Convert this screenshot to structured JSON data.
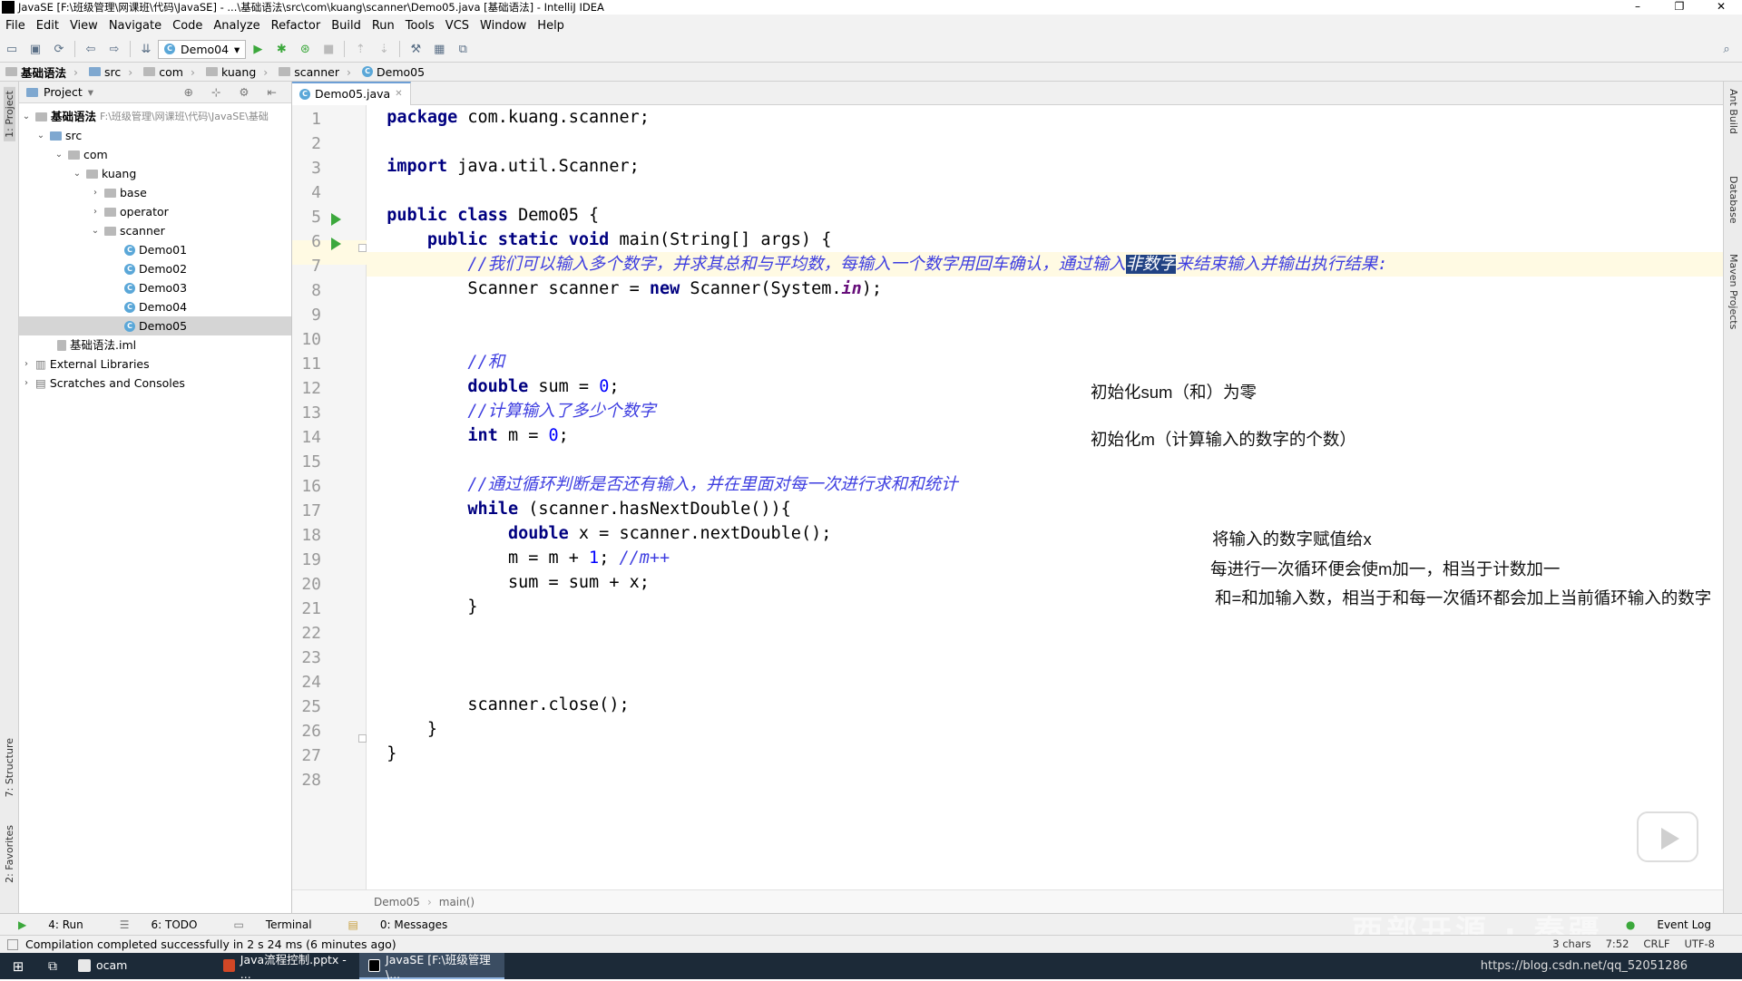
{
  "window": {
    "title": "JavaSE [F:\\班级管理\\网课班\\代码\\JavaSE] - ...\\基础语法\\src\\com\\kuang\\scanner\\Demo05.java [基础语法] - IntelliJ IDEA",
    "minimize": "–",
    "restore": "❐",
    "close": "✕"
  },
  "menu": [
    "File",
    "Edit",
    "View",
    "Navigate",
    "Code",
    "Analyze",
    "Refactor",
    "Build",
    "Run",
    "Tools",
    "VCS",
    "Window",
    "Help"
  ],
  "toolbar": {
    "run_config": "Demo04"
  },
  "breadcrumb": [
    "基础语法",
    "src",
    "com",
    "kuang",
    "scanner",
    "Demo05"
  ],
  "project_panel": {
    "title": "Project",
    "tree": [
      {
        "label": "基础语法",
        "hint": "F:\\班级管理\\网课班\\代码\\JavaSE\\基础"
      },
      {
        "label": "src"
      },
      {
        "label": "com"
      },
      {
        "label": "kuang"
      },
      {
        "label": "base"
      },
      {
        "label": "operator"
      },
      {
        "label": "scanner"
      },
      {
        "label": "Demo01"
      },
      {
        "label": "Demo02"
      },
      {
        "label": "Demo03"
      },
      {
        "label": "Demo04"
      },
      {
        "label": "Demo05"
      },
      {
        "label": "基础语法.iml"
      },
      {
        "label": "External Libraries"
      },
      {
        "label": "Scratches and Consoles"
      }
    ]
  },
  "side_tabs": {
    "left": [
      "1: Project",
      "7: Structure",
      "2: Favorites"
    ],
    "right": [
      "Ant Build",
      "Database",
      "Maven Projects"
    ]
  },
  "editor": {
    "tab": "Demo05.java",
    "code_breadcrumb": [
      "Demo05",
      "main()"
    ],
    "line_numbers": [
      "1",
      "2",
      "3",
      "4",
      "5",
      "6",
      "7",
      "8",
      "9",
      "10",
      "11",
      "12",
      "13",
      "14",
      "15",
      "16",
      "17",
      "18",
      "19",
      "20",
      "21",
      "22",
      "23",
      "24",
      "25",
      "26",
      "27",
      "28"
    ],
    "code": {
      "l1_kw": "package",
      "l1_rest": " com.kuang.scanner;",
      "l3_kw": "import",
      "l3_rest": " java.util.Scanner;",
      "l5_kw": "public class",
      "l5_rest": " Demo05 {",
      "l6_kw": "public static void",
      "l6_rest": " main(String[] args) {",
      "l7_pre": "//我们可以输入多个数字，并求其总和与平均数，每输入一个数字用回车确认，通过输入",
      "l7_sel": "非数字",
      "l7_post": "来结束输入并输出执行结果:",
      "l8_a": "Scanner scanner = ",
      "l8_kw": "new",
      "l8_b": " Scanner(System.",
      "l8_in": "in",
      "l8_c": ");",
      "l11": "//和",
      "l12_kw": "double",
      "l12_a": " sum = ",
      "l12_num": "0",
      "l12_b": ";",
      "l13": "//计算输入了多少个数字",
      "l14_kw": "int",
      "l14_a": " m = ",
      "l14_num": "0",
      "l14_b": ";",
      "l16": "//通过循环判断是否还有输入，并在里面对每一次进行求和和统计",
      "l17_kw": "while",
      "l17_rest": " (scanner.hasNextDouble()){",
      "l18_kw": "double",
      "l18_rest": " x = scanner.nextDouble();",
      "l19_a": "m = m + ",
      "l19_num": "1",
      "l19_b": "; ",
      "l19_cm": "//m++",
      "l20": "sum = sum + x;",
      "l21": "}",
      "l25": "scanner.close();",
      "l26": "}",
      "l27": "}"
    },
    "annotations": [
      "初始化sum（和）为零",
      "初始化m（计算输入的数字的个数）",
      "将输入的数字赋值给x",
      "每进行一次循环便会使m加一，相当于计数加一",
      "和=和加输入数，相当于和每一次循环都会加上当前循环输入的数字"
    ]
  },
  "bottom_tabs": [
    "4: Run",
    "6: TODO",
    "Terminal",
    "0: Messages",
    "Event Log"
  ],
  "status": {
    "message": "Compilation completed successfully in 2 s 24 ms (6 minutes ago)",
    "chars": "3 chars",
    "pos": "7:52",
    "eol": "CRLF",
    "encoding": "UTF-8"
  },
  "taskbar": {
    "items": [
      "ocam",
      "Java流程控制.pptx - ...",
      "JavaSE [F:\\班级管理\\..."
    ],
    "url_overlay": "https://blog.csdn.net/qq_52051286"
  },
  "watermark": "西部开源 · 秦疆",
  "colors": {
    "keyword": "#000080",
    "comment": "#3e3ee0",
    "number": "#0000ff",
    "selection": "#214283",
    "run_arrow": "#3ca83c"
  }
}
